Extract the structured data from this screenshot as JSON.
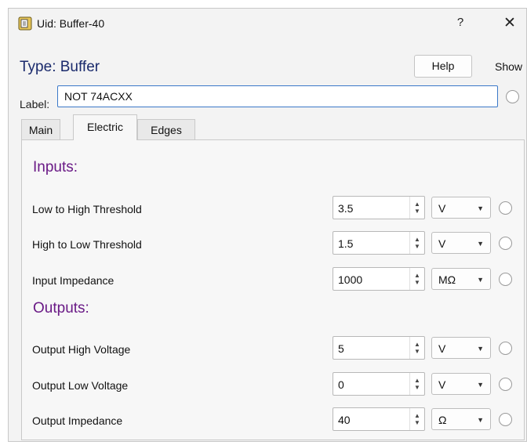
{
  "window": {
    "title": "Uid: Buffer-40",
    "help_glyph": "?",
    "close_glyph": "✕"
  },
  "header": {
    "type_title": "Type: Buffer",
    "help_button": "Help",
    "show_label": "Show"
  },
  "label_field": {
    "label": "Label:",
    "value": "NOT 74ACXX"
  },
  "tabs": [
    {
      "label": "Main",
      "active": false
    },
    {
      "label": "Electric",
      "active": true
    },
    {
      "label": "Edges",
      "active": false
    }
  ],
  "electric": {
    "inputs_heading": "Inputs:",
    "outputs_heading": "Outputs:",
    "inputs": [
      {
        "label": "Low to High Threshold",
        "value": "3.5",
        "unit": "V"
      },
      {
        "label": "High to Low Threshold",
        "value": "1.5",
        "unit": "V"
      },
      {
        "label": "Input Impedance",
        "value": "1000",
        "unit": "MΩ"
      }
    ],
    "outputs": [
      {
        "label": "Output High Voltage",
        "value": "5",
        "unit": "V"
      },
      {
        "label": "Output Low Voltage",
        "value": "0",
        "unit": "V"
      },
      {
        "label": "Output Impedance",
        "value": "40",
        "unit": "Ω"
      }
    ]
  },
  "icons": {
    "app": "chip-icon",
    "spin_up": "▲",
    "spin_down": "▼",
    "caret": "▼"
  }
}
